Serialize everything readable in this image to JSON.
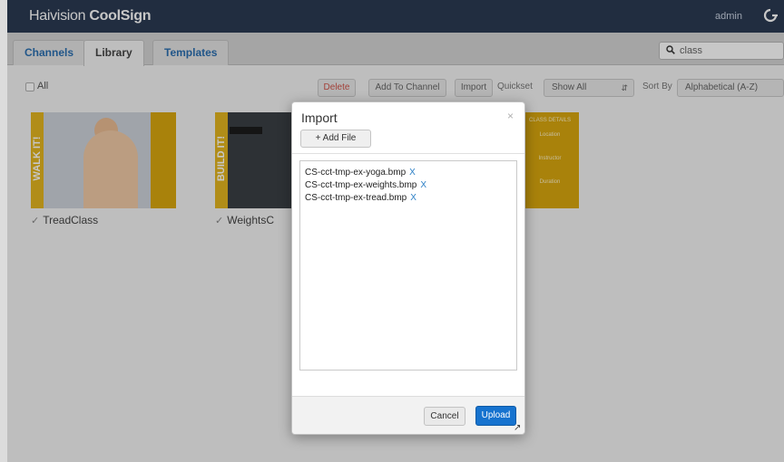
{
  "app": {
    "brand_prefix": "Haivision",
    "brand_suffix": " CoolSign",
    "user": "admin"
  },
  "tabs": [
    "Channels",
    "Library",
    "Templates"
  ],
  "search": {
    "value": "class"
  },
  "toolbar": {
    "all_label": "All",
    "delete_label": "Delete",
    "add_to_channel_label": "Add To Channel",
    "import_label": "Import",
    "quickset_label": "Quickset",
    "quickset_value": "Show All",
    "sort_label": "Sort By",
    "sort_value": "Alphabetical (A-Z)"
  },
  "library": {
    "items": [
      {
        "name": "TreadClass",
        "banner": "WALK IT!"
      },
      {
        "name": "WeightsC",
        "banner": "BUILD IT!"
      }
    ],
    "panel_lines": [
      "CLASS DETAILS",
      "Location",
      "Instructor",
      "Duration"
    ]
  },
  "modal": {
    "title": "Import",
    "close": "×",
    "add_file_label": "+ Add File",
    "files": [
      "CS-cct-tmp-ex-yoga.bmp",
      "CS-cct-tmp-ex-weights.bmp",
      "CS-cct-tmp-ex-tread.bmp"
    ],
    "remove_label": "X",
    "cancel_label": "Cancel",
    "upload_label": "Upload"
  }
}
